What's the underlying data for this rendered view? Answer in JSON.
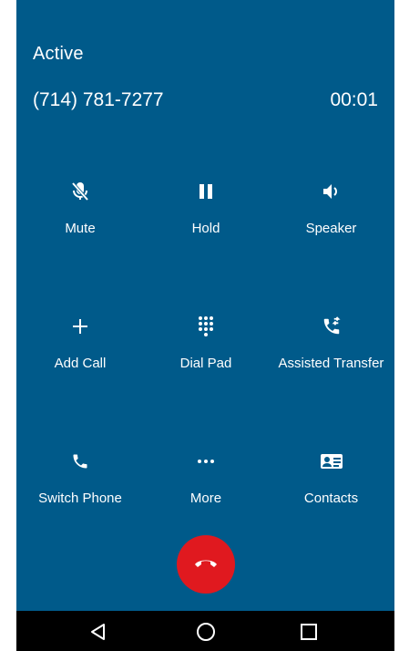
{
  "call": {
    "state": "Active",
    "number": "(714) 781-7277",
    "timer": "00:01"
  },
  "actions": [
    {
      "label": "Mute",
      "icon": "mic-off-icon"
    },
    {
      "label": "Hold",
      "icon": "pause-icon"
    },
    {
      "label": "Speaker",
      "icon": "speaker-icon"
    },
    {
      "label": "Add Call",
      "icon": "plus-icon"
    },
    {
      "label": "Dial Pad",
      "icon": "dialpad-icon"
    },
    {
      "label": "Assisted Transfer",
      "icon": "phone-transfer-icon"
    },
    {
      "label": "Switch Phone",
      "icon": "phone-icon"
    },
    {
      "label": "More",
      "icon": "more-icon"
    },
    {
      "label": "Contacts",
      "icon": "contact-card-icon"
    }
  ],
  "end_call": {
    "icon": "hang-up-icon"
  },
  "colors": {
    "background": "#005a8a",
    "text": "#ffffff",
    "hangup": "#e0191f",
    "navbar": "#000000"
  },
  "navbar": {
    "back_icon": "back-triangle-icon",
    "home_icon": "home-circle-icon",
    "recents_icon": "recents-square-icon"
  }
}
